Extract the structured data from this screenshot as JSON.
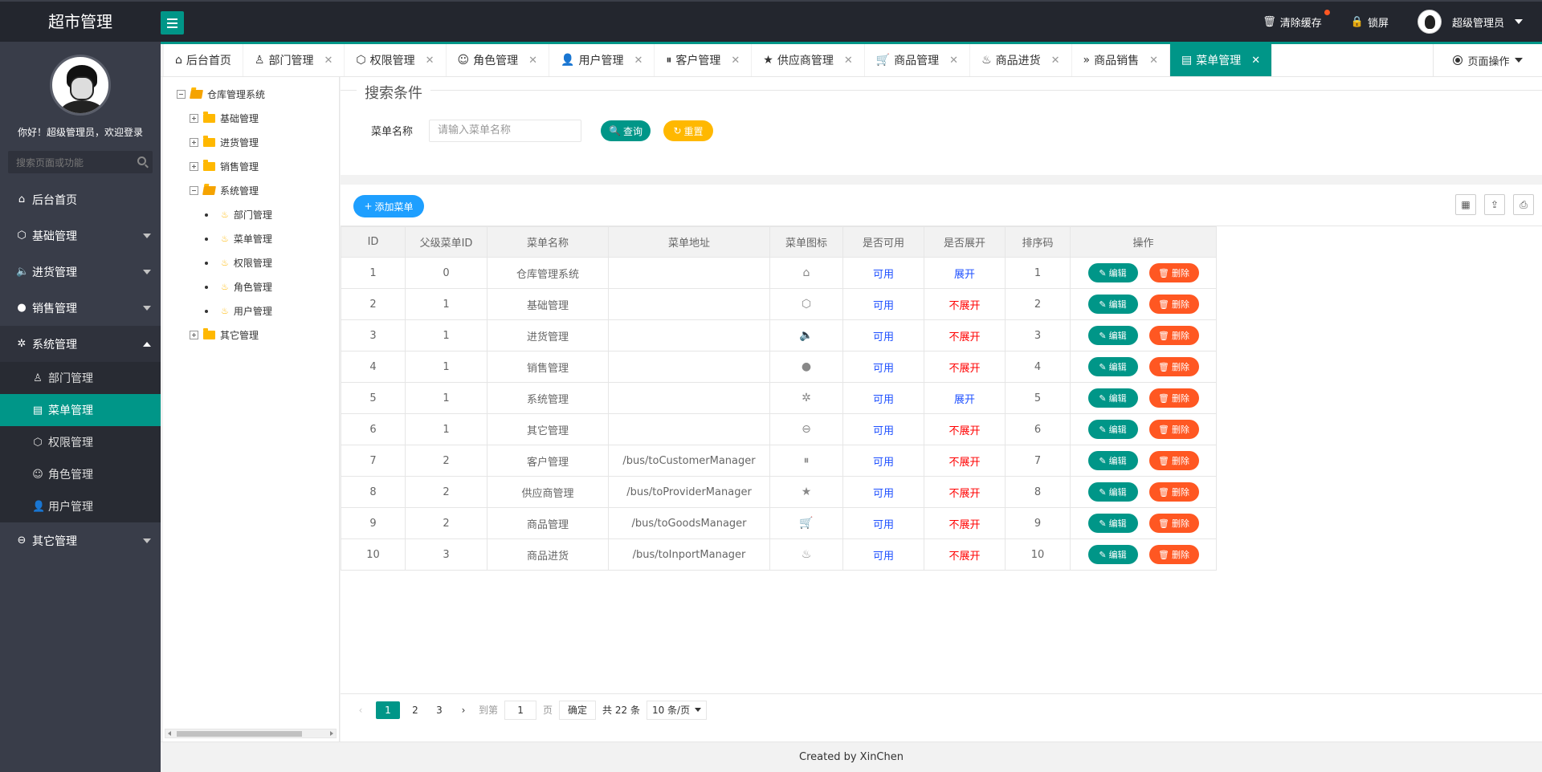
{
  "header": {
    "logo": "超市管理",
    "clear_cache": "清除缓存",
    "lock": "锁屏",
    "user": "超级管理员"
  },
  "sidebar": {
    "welcome": "你好！超级管理员，欢迎登录",
    "search_placeholder": "搜索页面或功能",
    "items": [
      {
        "label": "后台首页"
      },
      {
        "label": "基础管理"
      },
      {
        "label": "进货管理"
      },
      {
        "label": "销售管理"
      },
      {
        "label": "系统管理"
      },
      {
        "label": "其它管理"
      }
    ],
    "sub_items": [
      {
        "label": "部门管理"
      },
      {
        "label": "菜单管理"
      },
      {
        "label": "权限管理"
      },
      {
        "label": "角色管理"
      },
      {
        "label": "用户管理"
      }
    ]
  },
  "tabs": [
    {
      "label": "后台首页"
    },
    {
      "label": "部门管理"
    },
    {
      "label": "权限管理"
    },
    {
      "label": "角色管理"
    },
    {
      "label": "用户管理"
    },
    {
      "label": "客户管理"
    },
    {
      "label": "供应商管理"
    },
    {
      "label": "商品管理"
    },
    {
      "label": "商品进货"
    },
    {
      "label": "商品销售"
    },
    {
      "label": "菜单管理"
    }
  ],
  "page_ops": "页面操作",
  "tree": {
    "root": "仓库管理系统",
    "nodes": [
      "基础管理",
      "进货管理",
      "销售管理",
      "系统管理",
      "其它管理"
    ],
    "leaves": [
      "部门管理",
      "菜单管理",
      "权限管理",
      "角色管理",
      "用户管理"
    ]
  },
  "search": {
    "legend": "搜索条件",
    "label": "菜单名称",
    "placeholder": "请输入菜单名称",
    "query": "查询",
    "reset": "重置"
  },
  "toolbar": {
    "add": "添加菜单"
  },
  "table": {
    "columns": [
      "ID",
      "父级菜单ID",
      "菜单名称",
      "菜单地址",
      "菜单图标",
      "是否可用",
      "是否展开",
      "排序码",
      "操作"
    ],
    "edit_label": "编辑",
    "delete_label": "删除",
    "rows": [
      {
        "id": "1",
        "pid": "0",
        "name": "仓库管理系统",
        "href": "",
        "icon": "home-icon",
        "avail": "可用",
        "open": "展开",
        "sort": "1"
      },
      {
        "id": "2",
        "pid": "1",
        "name": "基础管理",
        "href": "",
        "icon": "cube-icon",
        "avail": "可用",
        "open": "不展开",
        "sort": "2"
      },
      {
        "id": "3",
        "pid": "1",
        "name": "进货管理",
        "href": "",
        "icon": "speaker-icon",
        "avail": "可用",
        "open": "不展开",
        "sort": "3"
      },
      {
        "id": "4",
        "pid": "1",
        "name": "销售管理",
        "href": "",
        "icon": "chat-icon",
        "avail": "可用",
        "open": "不展开",
        "sort": "4"
      },
      {
        "id": "5",
        "pid": "1",
        "name": "系统管理",
        "href": "",
        "icon": "gear-icon",
        "avail": "可用",
        "open": "展开",
        "sort": "5"
      },
      {
        "id": "6",
        "pid": "1",
        "name": "其它管理",
        "href": "",
        "icon": "circle-arrow-icon",
        "avail": "可用",
        "open": "不展开",
        "sort": "6"
      },
      {
        "id": "7",
        "pid": "2",
        "name": "客户管理",
        "href": "/bus/toCustomerManager",
        "icon": "pause-icon",
        "avail": "可用",
        "open": "不展开",
        "sort": "7"
      },
      {
        "id": "8",
        "pid": "2",
        "name": "供应商管理",
        "href": "/bus/toProviderManager",
        "icon": "star-icon",
        "avail": "可用",
        "open": "不展开",
        "sort": "8"
      },
      {
        "id": "9",
        "pid": "2",
        "name": "商品管理",
        "href": "/bus/toGoodsManager",
        "icon": "cart-icon",
        "avail": "可用",
        "open": "不展开",
        "sort": "9"
      },
      {
        "id": "10",
        "pid": "3",
        "name": "商品进货",
        "href": "/bus/toInportManager",
        "icon": "fire-icon",
        "avail": "可用",
        "open": "不展开",
        "sort": "10"
      }
    ]
  },
  "pager": {
    "pages": [
      "1",
      "2",
      "3"
    ],
    "goto": "到第",
    "page_value": "1",
    "page_unit": "页",
    "confirm": "确定",
    "total": "共 22 条",
    "per_page": "10 条/页"
  },
  "footer": "Created by XinChen",
  "colors": {
    "header_bg": "#23262e",
    "sidebar_bg": "#393d49",
    "accent": "#009688",
    "warning": "#ffb800",
    "danger": "#ff5722",
    "primary": "#1e9fff"
  }
}
